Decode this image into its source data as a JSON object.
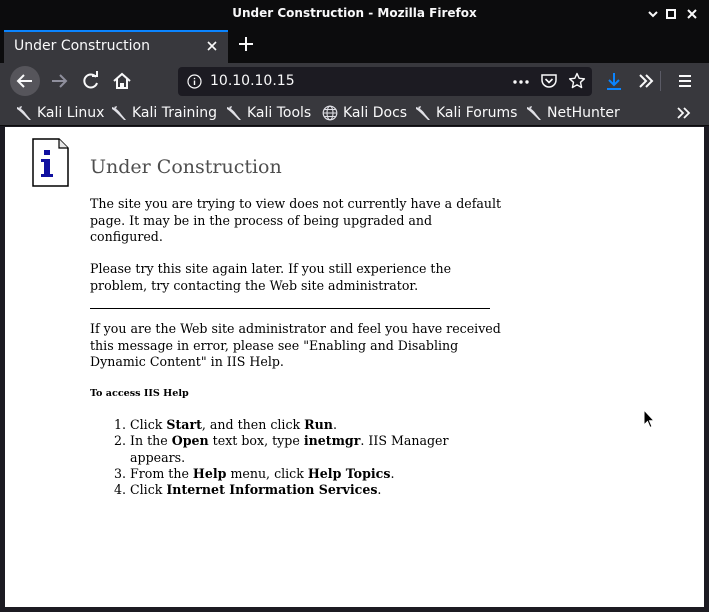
{
  "window": {
    "title": "Under Construction - Mozilla Firefox"
  },
  "tabs": [
    {
      "label": "Under Construction"
    }
  ],
  "navbar": {
    "url": "10.10.10.15"
  },
  "bookmarks": [
    {
      "label": "Kali Linux",
      "icon": "kali-dragon-icon"
    },
    {
      "label": "Kali Training",
      "icon": "kali-dragon-icon"
    },
    {
      "label": "Kali Tools",
      "icon": "kali-dragon-icon"
    },
    {
      "label": "Kali Docs",
      "icon": "globe-icon"
    },
    {
      "label": "Kali Forums",
      "icon": "kali-dragon-icon"
    },
    {
      "label": "NetHunter",
      "icon": "kali-dragon-icon"
    }
  ],
  "page": {
    "title": "Under Construction",
    "para1": "The site you are trying to view does not currently have a default page. It may be in the process of being upgraded and configured.",
    "para2": "Please try this site again later. If you still experience the problem, try contacting the Web site administrator.",
    "para3": "If you are the Web site administrator and feel you have received this message in error, please see \"Enabling and Disabling Dynamic Content\" in IIS Help.",
    "help_heading": "To access IIS Help",
    "steps": [
      {
        "a": "Click ",
        "b1": "Start",
        "c": ", and then click ",
        "b2": "Run",
        "d": "."
      },
      {
        "a": "In the ",
        "b1": "Open",
        "c": " text box, type ",
        "b2": "inetmgr",
        "d": ". IIS Manager appears."
      },
      {
        "a": "From the ",
        "b1": "Help",
        "c": " menu, click ",
        "b2": "Help Topics",
        "d": "."
      },
      {
        "a": "Click ",
        "b1": "Internet Information Services",
        "c": "",
        "b2": "",
        "d": "."
      }
    ]
  },
  "colors": {
    "accent": "#0a84ff",
    "download": "#0a84ff",
    "toolbar": "#38383d",
    "titlebar": "#0c0c0d"
  }
}
